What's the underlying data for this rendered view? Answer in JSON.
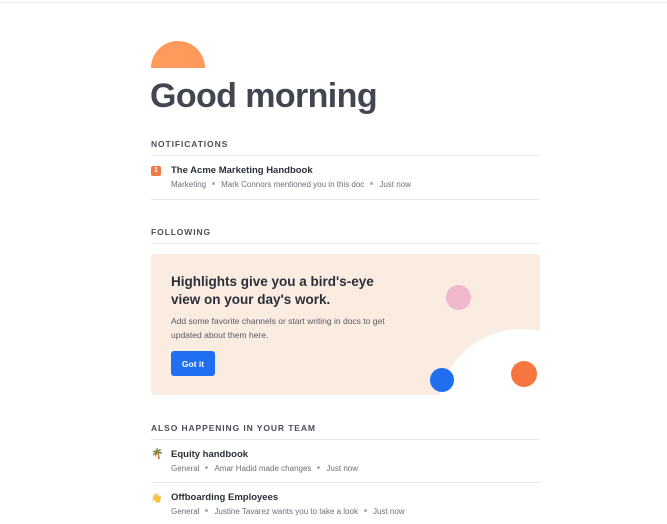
{
  "greeting": "Good morning",
  "sections": {
    "notifications_label": "NOTIFICATIONS",
    "following_label": "FOLLOWING",
    "team_label": "ALSO HAPPENING IN YOUR TEAM"
  },
  "notifications": [
    {
      "badge": "1",
      "title": "The Acme Marketing Handbook",
      "channel": "Marketing",
      "activity": "Mark Connors mentioned you in this doc",
      "time": "Just now"
    }
  ],
  "highlights_card": {
    "heading": "Highlights give you a bird's-eye view on your day's work.",
    "body": "Add some favorite channels or start writing in docs to get updated about them here.",
    "button_label": "Got it",
    "colors": {
      "background": "#fbece2",
      "button": "#1f6ff0"
    }
  },
  "team_activity": [
    {
      "icon": "palm-tree-icon",
      "title": "Equity handbook",
      "channel": "General",
      "activity": "Amar Hadid made changes",
      "time": "Just now"
    },
    {
      "icon": "waving-hand-icon",
      "title": "Offboarding Employees",
      "channel": "General",
      "activity": "Justine Tavarez wants you to take a look",
      "time": "Just now"
    }
  ],
  "colors": {
    "accent": "#1f6ff0",
    "sun": "#ff9a5c",
    "badge": "#ef7a44"
  }
}
